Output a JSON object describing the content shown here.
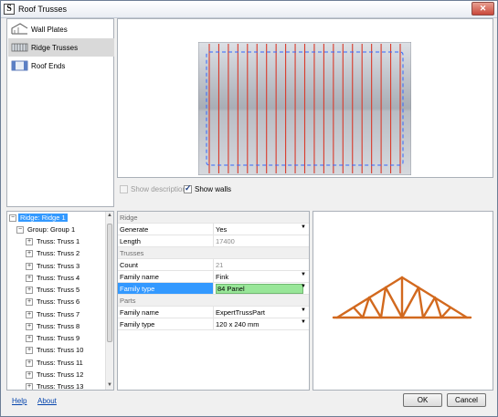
{
  "window": {
    "title": "Roof Trusses",
    "app_letter": "S",
    "close_glyph": "✕"
  },
  "categories": [
    {
      "label": "Wall Plates",
      "icon": "wall-plates-icon"
    },
    {
      "label": "Ridge Trusses",
      "icon": "ridge-trusses-icon",
      "selected": true
    },
    {
      "label": "Roof Ends",
      "icon": "roof-ends-icon"
    }
  ],
  "options": {
    "show_descriptions": {
      "label": "Show descriptions",
      "checked": false,
      "enabled": false
    },
    "show_walls": {
      "label": "Show walls",
      "checked": true,
      "enabled": true
    }
  },
  "tree": {
    "root": "Ridge: Ridge 1",
    "group": "Group: Group 1",
    "trusses": [
      "Truss: Truss 1",
      "Truss: Truss 2",
      "Truss: Truss 3",
      "Truss: Truss 4",
      "Truss: Truss 5",
      "Truss: Truss 6",
      "Truss: Truss 7",
      "Truss: Truss 8",
      "Truss: Truss 9",
      "Truss: Truss 10",
      "Truss: Truss 11",
      "Truss: Truss 12",
      "Truss: Truss 13"
    ]
  },
  "properties": {
    "ridge_header": "Ridge",
    "generate": {
      "name": "Generate",
      "value": "Yes"
    },
    "length": {
      "name": "Length",
      "value": "17400"
    },
    "trusses_header": "Trusses",
    "count": {
      "name": "Count",
      "value": "21"
    },
    "family_name": {
      "name": "Family name",
      "value": "Fink"
    },
    "family_type": {
      "name": "Family type",
      "value": "84 Panel"
    },
    "parts_header": "Parts",
    "parts_family_name": {
      "name": "Family name",
      "value": "ExpertTrussPart"
    },
    "parts_family_type": {
      "name": "Family type",
      "value": "120 x 240 mm"
    }
  },
  "footer": {
    "help": "Help",
    "about": "About",
    "ok": "OK",
    "cancel": "Cancel"
  },
  "colors": {
    "accent": "#3399ff",
    "truss": "#d2691e",
    "rafter_line": "#d93a2b",
    "wall_outline": "#3366ff"
  }
}
